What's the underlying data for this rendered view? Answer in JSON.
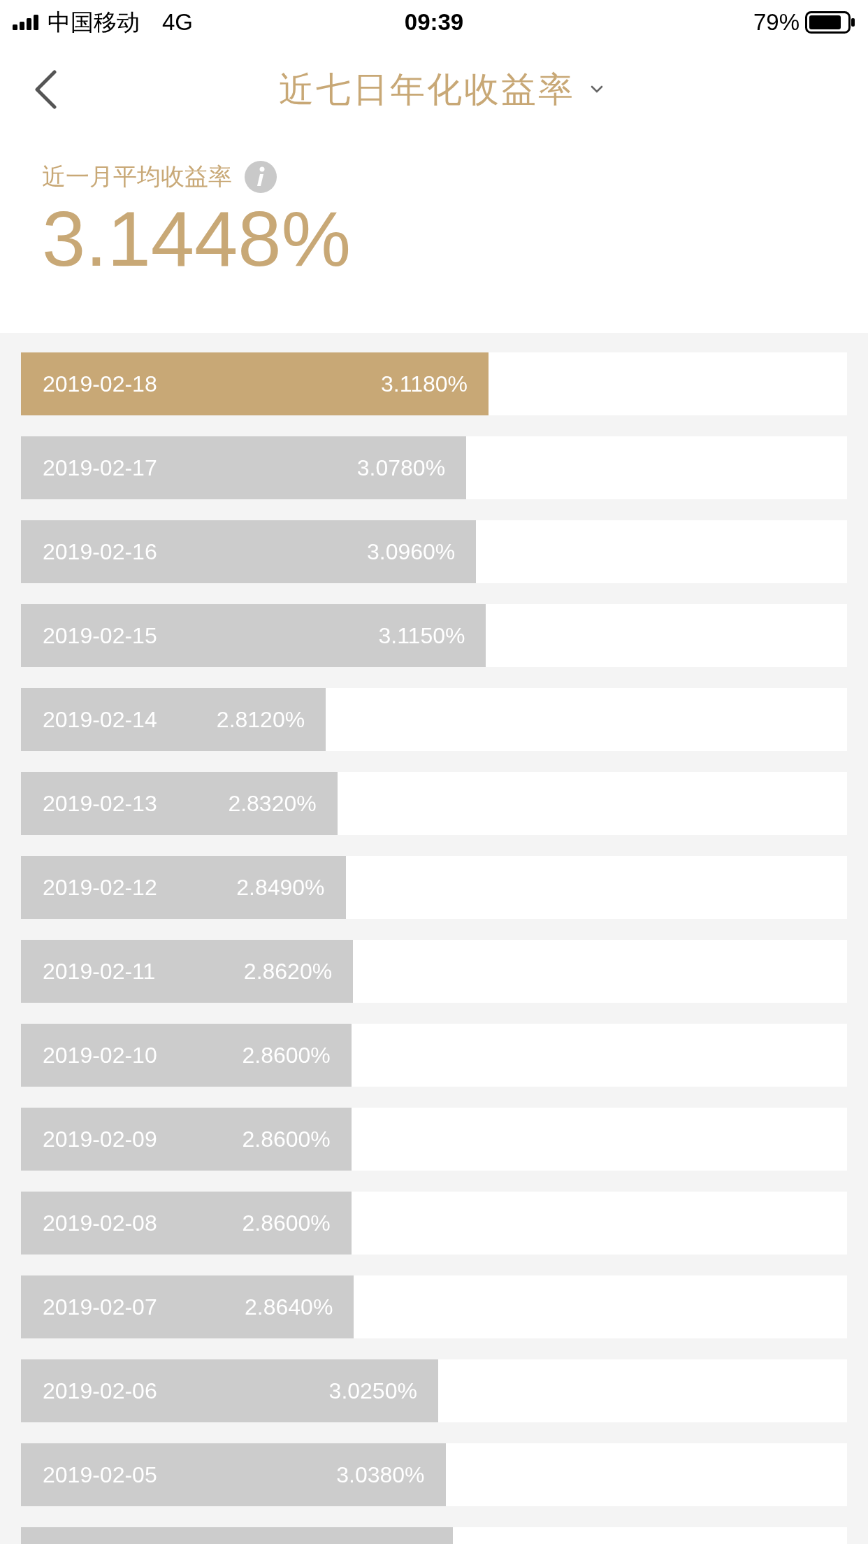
{
  "status_bar": {
    "carrier": "中国移动",
    "network": "4G",
    "time": "09:39",
    "battery": "79%"
  },
  "nav": {
    "title": "近七日年化收益率"
  },
  "summary": {
    "label": "近一月平均收益率",
    "value": "3.1448%"
  },
  "rows": [
    {
      "date": "2019-02-18",
      "value": "3.1180%",
      "level": 0.566,
      "selected": true
    },
    {
      "date": "2019-02-17",
      "value": "3.0780%",
      "level": 0.539,
      "selected": false
    },
    {
      "date": "2019-02-16",
      "value": "3.0960%",
      "level": 0.551,
      "selected": false
    },
    {
      "date": "2019-02-15",
      "value": "3.1150%",
      "level": 0.563,
      "selected": false
    },
    {
      "date": "2019-02-14",
      "value": "2.8120%",
      "level": 0.369,
      "selected": false
    },
    {
      "date": "2019-02-13",
      "value": "2.8320%",
      "level": 0.383,
      "selected": false
    },
    {
      "date": "2019-02-12",
      "value": "2.8490%",
      "level": 0.393,
      "selected": false
    },
    {
      "date": "2019-02-11",
      "value": "2.8620%",
      "level": 0.402,
      "selected": false
    },
    {
      "date": "2019-02-10",
      "value": "2.8600%",
      "level": 0.4,
      "selected": false
    },
    {
      "date": "2019-02-09",
      "value": "2.8600%",
      "level": 0.4,
      "selected": false
    },
    {
      "date": "2019-02-08",
      "value": "2.8600%",
      "level": 0.4,
      "selected": false
    },
    {
      "date": "2019-02-07",
      "value": "2.8640%",
      "level": 0.403,
      "selected": false
    },
    {
      "date": "2019-02-06",
      "value": "3.0250%",
      "level": 0.505,
      "selected": false
    },
    {
      "date": "2019-02-05",
      "value": "3.0380%",
      "level": 0.514,
      "selected": false
    },
    {
      "level": 0.523,
      "selected": false
    }
  ]
}
